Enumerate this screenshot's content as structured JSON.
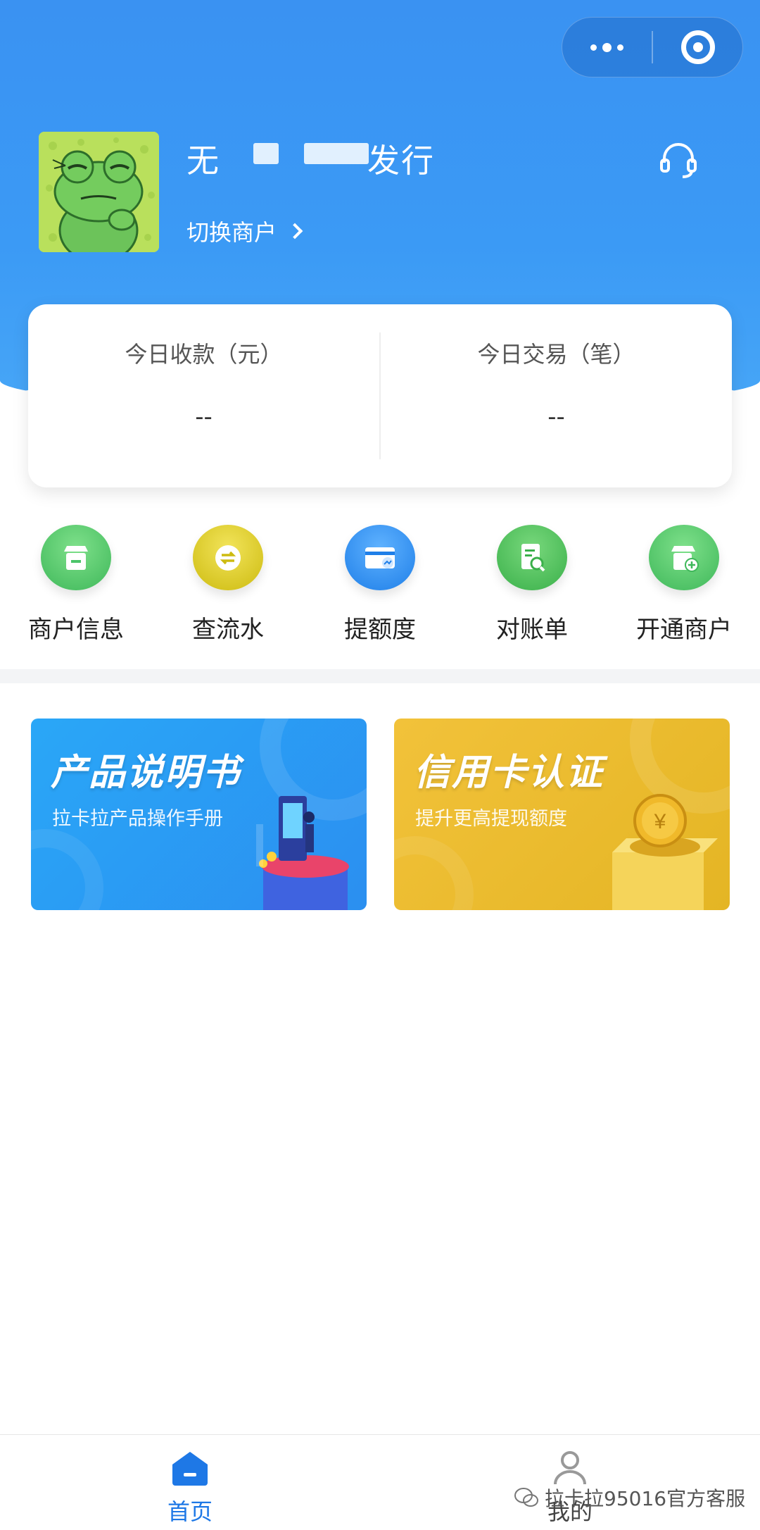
{
  "header": {
    "merchant_name_start": "无",
    "merchant_name_end": "发行",
    "switch_merchant_label": "切换商户"
  },
  "stats": {
    "today_collection_label": "今日收款（元）",
    "today_collection_value": "--",
    "today_transactions_label": "今日交易（笔）",
    "today_transactions_value": "--"
  },
  "quick_menu": [
    {
      "label": "商户信息",
      "icon": "store-icon",
      "color": "#4cc56a"
    },
    {
      "label": "查流水",
      "icon": "exchange-icon",
      "color": "#d9c81a"
    },
    {
      "label": "提额度",
      "icon": "card-chart-icon",
      "color": "#2d8ef2"
    },
    {
      "label": "对账单",
      "icon": "document-search-icon",
      "color": "#4cbf5a"
    },
    {
      "label": "开通商户",
      "icon": "store-add-icon",
      "color": "#4cc56a"
    }
  ],
  "banners": [
    {
      "title": "产品说明书",
      "subtitle": "拉卡拉产品操作手册",
      "color": "#2aa0f6"
    },
    {
      "title": "信用卡认证",
      "subtitle": "提升更高提现额度",
      "color": "#ecbd2e"
    }
  ],
  "bottom_nav": {
    "home_label": "首页",
    "mine_label": "我的",
    "active_color": "#1e78e6"
  },
  "watermark": "拉卡拉95016官方客服"
}
